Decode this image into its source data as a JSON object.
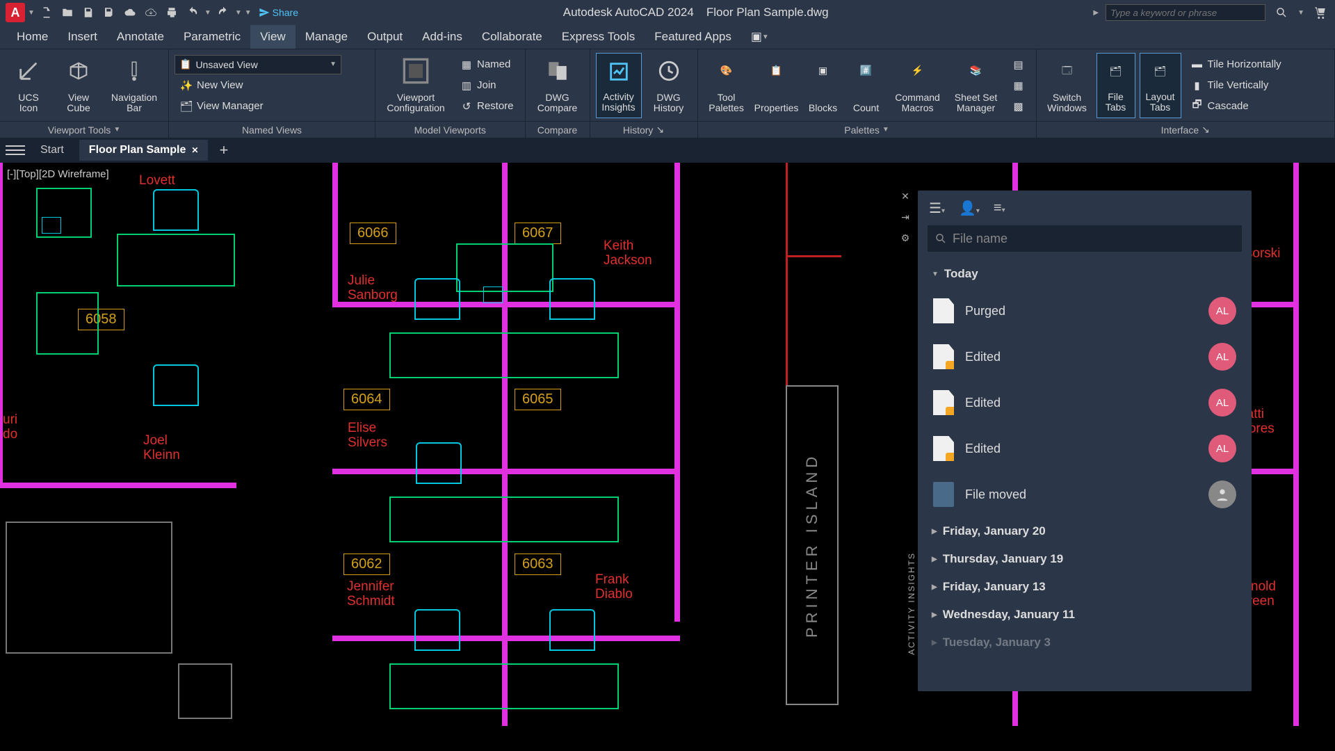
{
  "titlebar": {
    "share": "Share",
    "app": "Autodesk AutoCAD 2024",
    "file": "Floor Plan Sample.dwg",
    "search_ph": "Type a keyword or phrase"
  },
  "menus": [
    "Home",
    "Insert",
    "Annotate",
    "Parametric",
    "View",
    "Manage",
    "Output",
    "Add-ins",
    "Collaborate",
    "Express Tools",
    "Featured Apps"
  ],
  "active_menu": "View",
  "ribbon": {
    "viewport_tools": {
      "ucs": "UCS\nIcon",
      "viewcube": "View\nCube",
      "nav": "Navigation\nBar",
      "title": "Viewport Tools"
    },
    "named_views": {
      "dd": "Unsaved View",
      "new": "New View",
      "mgr": "View Manager",
      "title": "Named Views"
    },
    "model_vp": {
      "cfg": "Viewport\nConfiguration",
      "named": "Named",
      "join": "Join",
      "restore": "Restore",
      "title": "Model Viewports"
    },
    "compare": {
      "btn": "DWG\nCompare",
      "title": "Compare"
    },
    "history": {
      "activity": "Activity\nInsights",
      "dwg": "DWG\nHistory",
      "title": "History"
    },
    "palettes": {
      "tool": "Tool\nPalettes",
      "props": "Properties",
      "blocks": "Blocks",
      "count": "Count",
      "macros": "Command\nMacros",
      "sheet": "Sheet Set\nManager",
      "title": "Palettes"
    },
    "interface": {
      "switch": "Switch\nWindows",
      "filetabs": "File\nTabs",
      "layouttabs": "Layout\nTabs",
      "h": "Tile Horizontally",
      "v": "Tile Vertically",
      "c": "Cascade",
      "title": "Interface"
    }
  },
  "filetabs": {
    "start": "Start",
    "doc": "Floor Plan Sample"
  },
  "viewlabel": "[-][Top][2D Wireframe]",
  "rooms": {
    "r6058": "6058",
    "r6062": "6062",
    "r6063": "6063",
    "r6064": "6064",
    "r6065": "6065",
    "r6066": "6066",
    "r6067": "6067"
  },
  "names": {
    "lovett": "Lovett",
    "julie": "Julie\nSanborg",
    "keith": "Keith\nJackson",
    "joel": "Joel\nKleinn",
    "elise": "Elise\nSilvers",
    "jennifer": "Jennifer\nSchmidt",
    "frank": "Frank\nDiablo",
    "uri": "uri\ndo",
    "patti": "Patti\nMores",
    "arnold": "Arnold\nGreen",
    "mussorski": "rt\nMussorski"
  },
  "printer": "PRINTER ISLAND",
  "activity": {
    "label": "ACTIVITY INSIGHTS",
    "search_ph": "File name",
    "today": "Today",
    "items": [
      {
        "label": "Purged",
        "avatar": "AL",
        "badge": false
      },
      {
        "label": "Edited",
        "avatar": "AL",
        "badge": true
      },
      {
        "label": "Edited",
        "avatar": "AL",
        "badge": true
      },
      {
        "label": "Edited",
        "avatar": "AL",
        "badge": true
      },
      {
        "label": "File moved",
        "avatar": "",
        "badge": false
      }
    ],
    "dates": [
      "Friday, January 20",
      "Thursday, January 19",
      "Friday, January 13",
      "Wednesday, January 11",
      "Tuesday, January 3"
    ]
  }
}
